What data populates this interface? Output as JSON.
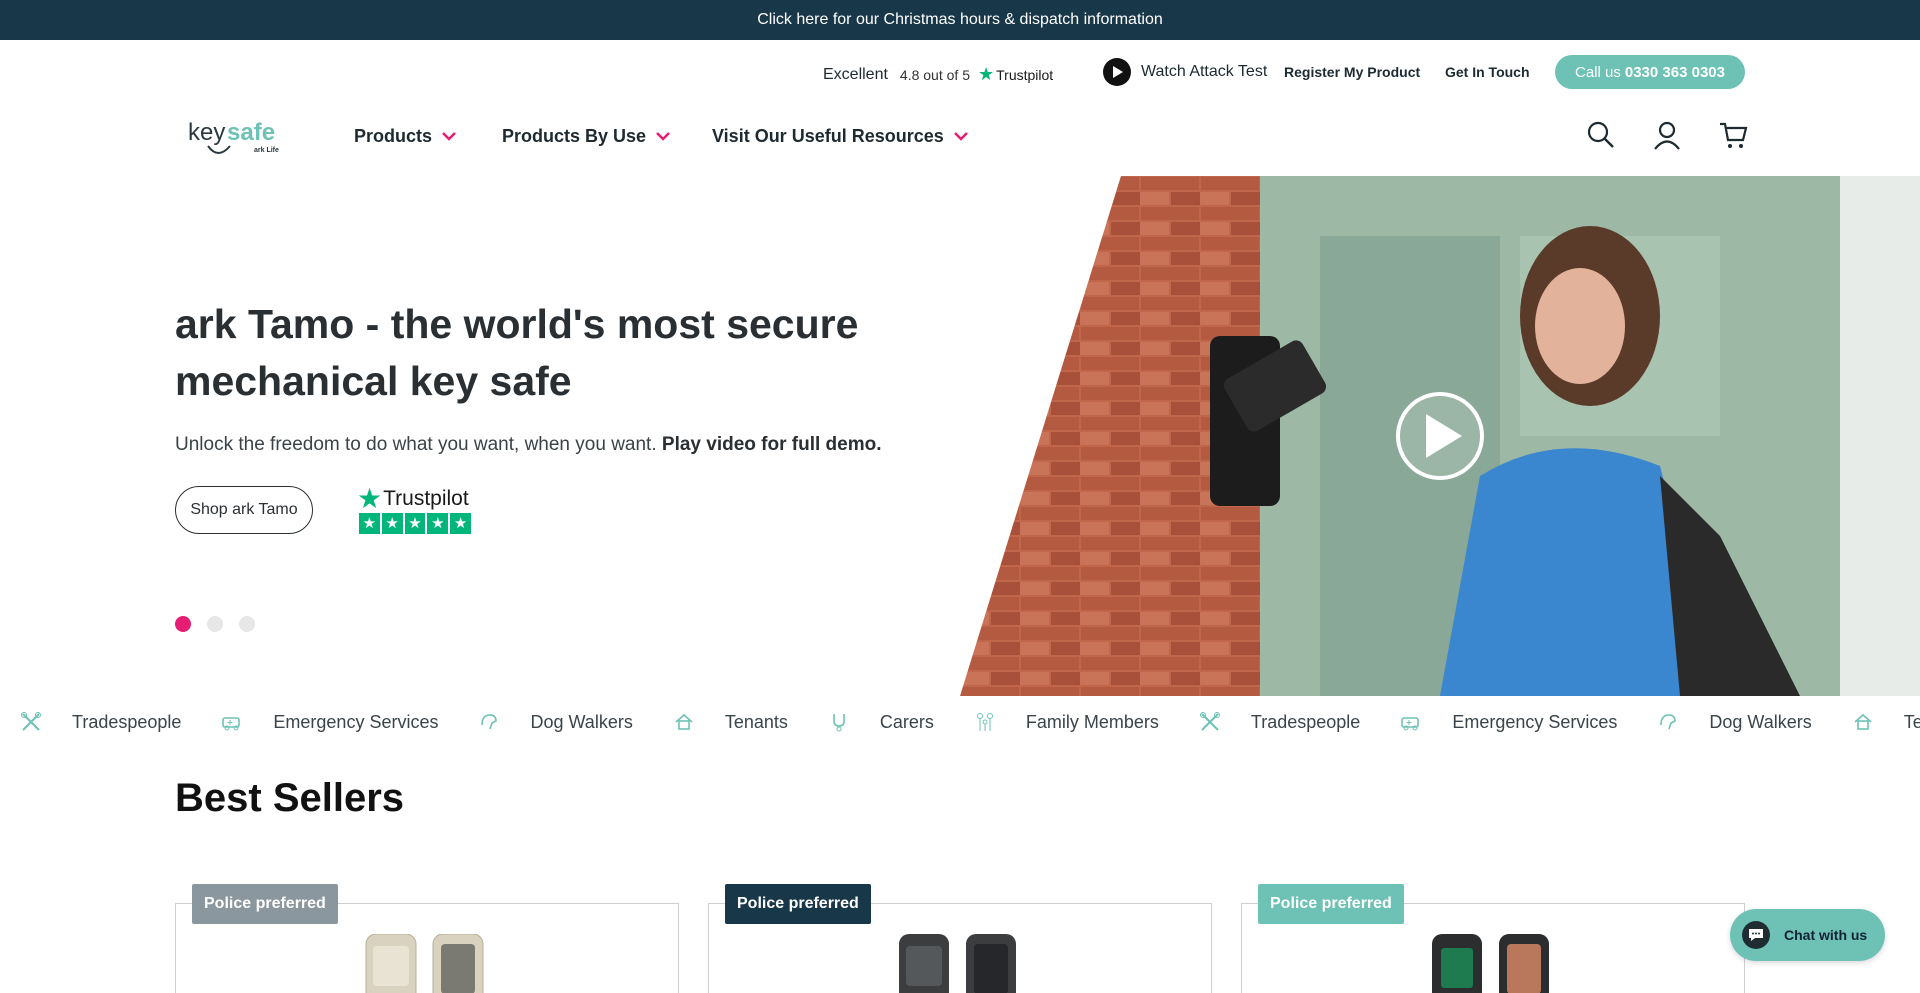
{
  "announcement": "Click here for our Christmas hours & dispatch information",
  "utility": {
    "trustpilot_rating_word": "Excellent",
    "trustpilot_score": "4.8 out of 5",
    "trustpilot_brand": "Trustpilot",
    "watch_attack_test": "Watch Attack Test",
    "register_product": "Register My Product",
    "get_in_touch": "Get In Touch",
    "call_prefix": "Call us",
    "call_number": "0330 363 0303"
  },
  "logo": {
    "text_key": "key",
    "text_safe": "safe",
    "sub": "ark Life"
  },
  "nav": {
    "items": [
      {
        "label": "Products"
      },
      {
        "label": "Products By Use"
      },
      {
        "label": "Visit Our Useful Resources"
      }
    ],
    "icons": [
      "search-icon",
      "account-icon",
      "cart-icon"
    ]
  },
  "hero": {
    "title": "ark Tamo - the world's most secure mechanical key safe",
    "subtitle": "Unlock the freedom to do what you want, when you want.",
    "subtitle_bold": "Play video for full demo.",
    "cta": "Shop ark Tamo",
    "trustpilot_brand": "Trustpilot",
    "slides_total": 3,
    "active_slide": 1
  },
  "ticker": [
    "Tradespeople",
    "Emergency Services",
    "Dog Walkers",
    "Tenants",
    "Carers",
    "Family Members",
    "Tradespeople",
    "Emergency Services",
    "Dog Walkers",
    "Te"
  ],
  "best_sellers": {
    "title": "Best Sellers",
    "cards": [
      {
        "badge": "Police preferred",
        "badge_color": "#8a979e"
      },
      {
        "badge": "Police preferred",
        "badge_color": "#183749"
      },
      {
        "badge": "Police preferred",
        "badge_color": "#6dc2b5"
      }
    ]
  },
  "chat": {
    "label": "Chat with us"
  },
  "colors": {
    "navy": "#183749",
    "teal": "#6dc2b5",
    "pink": "#e61e73",
    "trustpilot_green": "#00b67a"
  }
}
